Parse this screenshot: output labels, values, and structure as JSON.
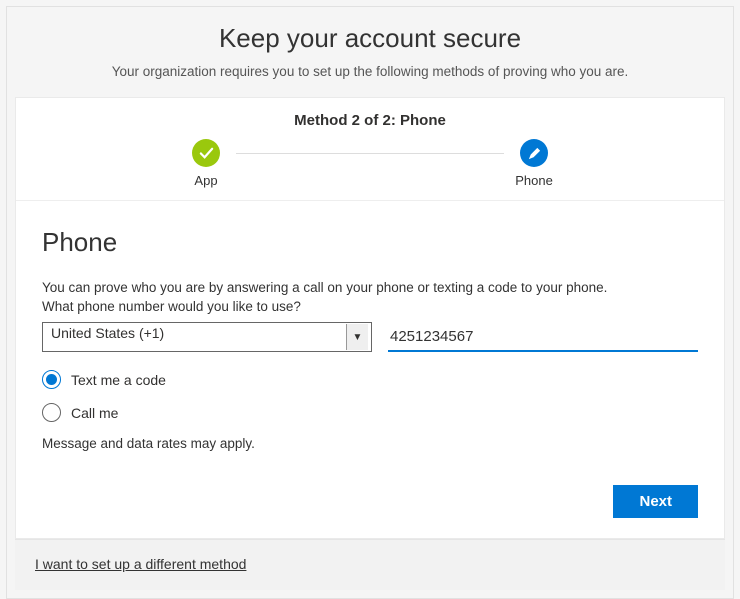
{
  "header": {
    "title": "Keep your account secure",
    "subheading": "Your organization requires you to set up the following methods of proving who you are."
  },
  "stepper": {
    "title": "Method 2 of 2: Phone",
    "steps": [
      {
        "label": "App",
        "icon": "check",
        "color": "green",
        "completed": true
      },
      {
        "label": "Phone",
        "icon": "pencil",
        "color": "blue",
        "active": true
      }
    ]
  },
  "form": {
    "heading": "Phone",
    "description": "You can prove who you are by answering a call on your phone or texting a code to your phone.",
    "prompt": "What phone number would you like to use?",
    "country": {
      "selected": "United States (+1)"
    },
    "phone_value": "4251234567",
    "options": [
      {
        "label": "Text me a code",
        "selected": true
      },
      {
        "label": "Call me",
        "selected": false
      }
    ],
    "rates_note": "Message and data rates may apply."
  },
  "actions": {
    "next_label": "Next"
  },
  "footer": {
    "different_method": "I want to set up a different method"
  }
}
